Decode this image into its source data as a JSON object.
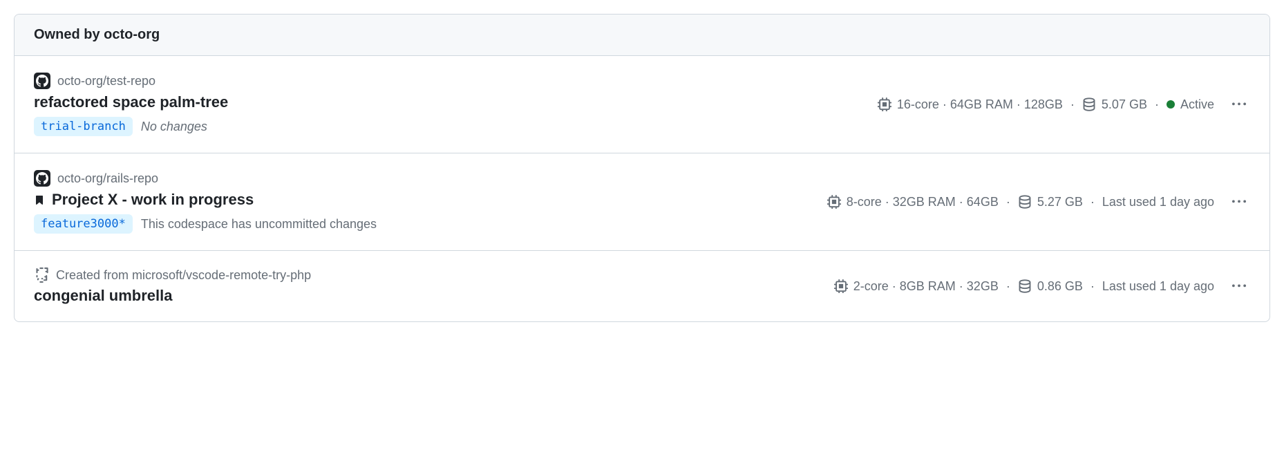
{
  "header": {
    "title": "Owned by octo-org"
  },
  "codespaces": [
    {
      "repo": "octo-org/test-repo",
      "name": "refactored space palm-tree",
      "branch": "trial-branch",
      "branchStatus": "No changes",
      "specs": "16-core · 64GB RAM · 128GB",
      "storage": "5.07 GB",
      "activity": "Active",
      "hasActiveDot": true,
      "hasBookmark": false,
      "iconType": "github"
    },
    {
      "repo": "octo-org/rails-repo",
      "name": "Project X - work in progress",
      "branch": "feature3000*",
      "branchStatus": "This codespace has uncommitted changes",
      "specs": "8-core · 32GB RAM · 64GB",
      "storage": "5.27 GB",
      "activity": "Last used 1 day ago",
      "hasActiveDot": false,
      "hasBookmark": true,
      "iconType": "github"
    },
    {
      "repo": "Created from microsoft/vscode-remote-try-php",
      "name": "congenial umbrella",
      "branch": null,
      "branchStatus": null,
      "specs": "2-core · 8GB RAM · 32GB",
      "storage": "0.86 GB",
      "activity": "Last used 1 day ago",
      "hasActiveDot": false,
      "hasBookmark": false,
      "iconType": "template"
    }
  ]
}
